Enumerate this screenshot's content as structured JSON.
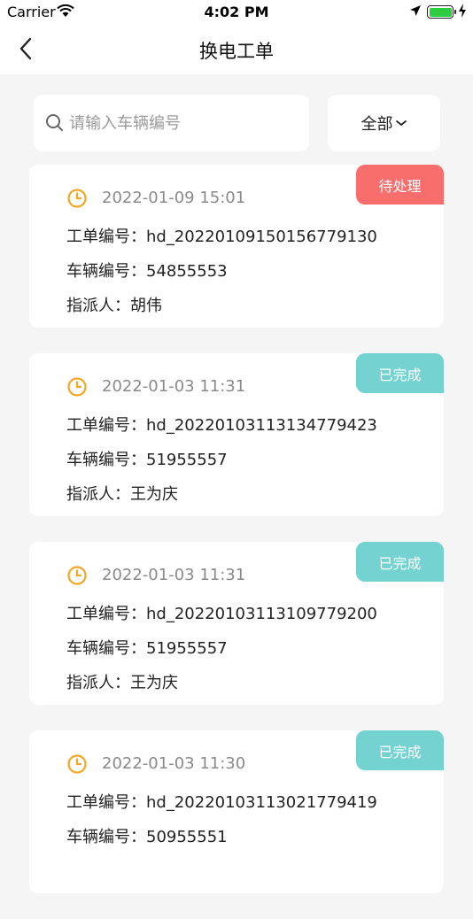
{
  "status_bar": {
    "carrier": "Carrier",
    "time": "4:02 PM"
  },
  "nav": {
    "title": "换电工单"
  },
  "search": {
    "placeholder": "请输入车辆编号",
    "value": ""
  },
  "filter": {
    "label": "全部"
  },
  "labels": {
    "order_no": "工单编号：",
    "vehicle_no": "车辆编号：",
    "assignee": "指派人："
  },
  "colors": {
    "pending": "#f76e6d",
    "done": "#74d2d0",
    "clock": "#f5a623"
  },
  "orders": [
    {
      "status": "待处理",
      "status_type": "pending",
      "time": "2022-01-09 15:01",
      "order_no": "hd_20220109150156779130",
      "vehicle_no": "54855553",
      "assignee": "胡伟"
    },
    {
      "status": "已完成",
      "status_type": "done",
      "time": "2022-01-03 11:31",
      "order_no": "hd_20220103113134779423",
      "vehicle_no": "51955557",
      "assignee": "王为庆"
    },
    {
      "status": "已完成",
      "status_type": "done",
      "time": "2022-01-03 11:31",
      "order_no": "hd_20220103113109779200",
      "vehicle_no": "51955557",
      "assignee": "王为庆"
    },
    {
      "status": "已完成",
      "status_type": "done",
      "time": "2022-01-03 11:30",
      "order_no": "hd_20220103113021779419",
      "vehicle_no": "50955551",
      "assignee": ""
    }
  ]
}
